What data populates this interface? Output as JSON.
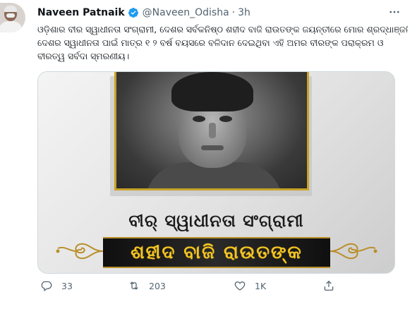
{
  "tweet": {
    "author_name": "Naveen Patnaik",
    "handle": "@Naveen_Odisha",
    "separator": "·",
    "time": "3h",
    "more_icon": "more-icon",
    "text_lines": [
      "ଓଡ଼ିଶାର ବୀର ସ୍ୱାଧୀନତା ସଂଗ୍ରାମୀ, ଦେଶର ସର୍ବକନିଷ୍ଠ ଶହୀଦ ବାଜି ରାଉତଙ୍କ ଜୟନ୍ତୀରେ ମୋର ଶ୍ରଦ୍ଧାଞ୍ଜଳି।",
      "ଦେଶର ସ୍ୱାଧୀନତା ପାଇଁ ମାତ୍ର ୧ ୨ ବର୍ଷ ବୟସରେ ବଳିଦାନ ଦେଇଥିବା ଏହି ଅମର ବୀରଙ୍କ ପରାକ୍ରମ ଓ",
      "ବୀରତ୍ୱ ସର୍ବଦା ସ୍ମରଣୀୟ।"
    ],
    "image": {
      "caption_top": "ବୀର୍ ସ୍ୱାଧୀନତା ସଂଗ୍ରାମୀ",
      "caption_banner": "ଶହୀଦ ବାଜି ରାଉତଙ୍କ"
    },
    "actions": {
      "reply_count": "33",
      "retweet_count": "203",
      "like_count": "1K",
      "share_label": ""
    }
  },
  "colors": {
    "verified": "#1d9bf0",
    "muted": "#536471",
    "banner_text": "#f3c623",
    "gold": "#c9a227"
  }
}
